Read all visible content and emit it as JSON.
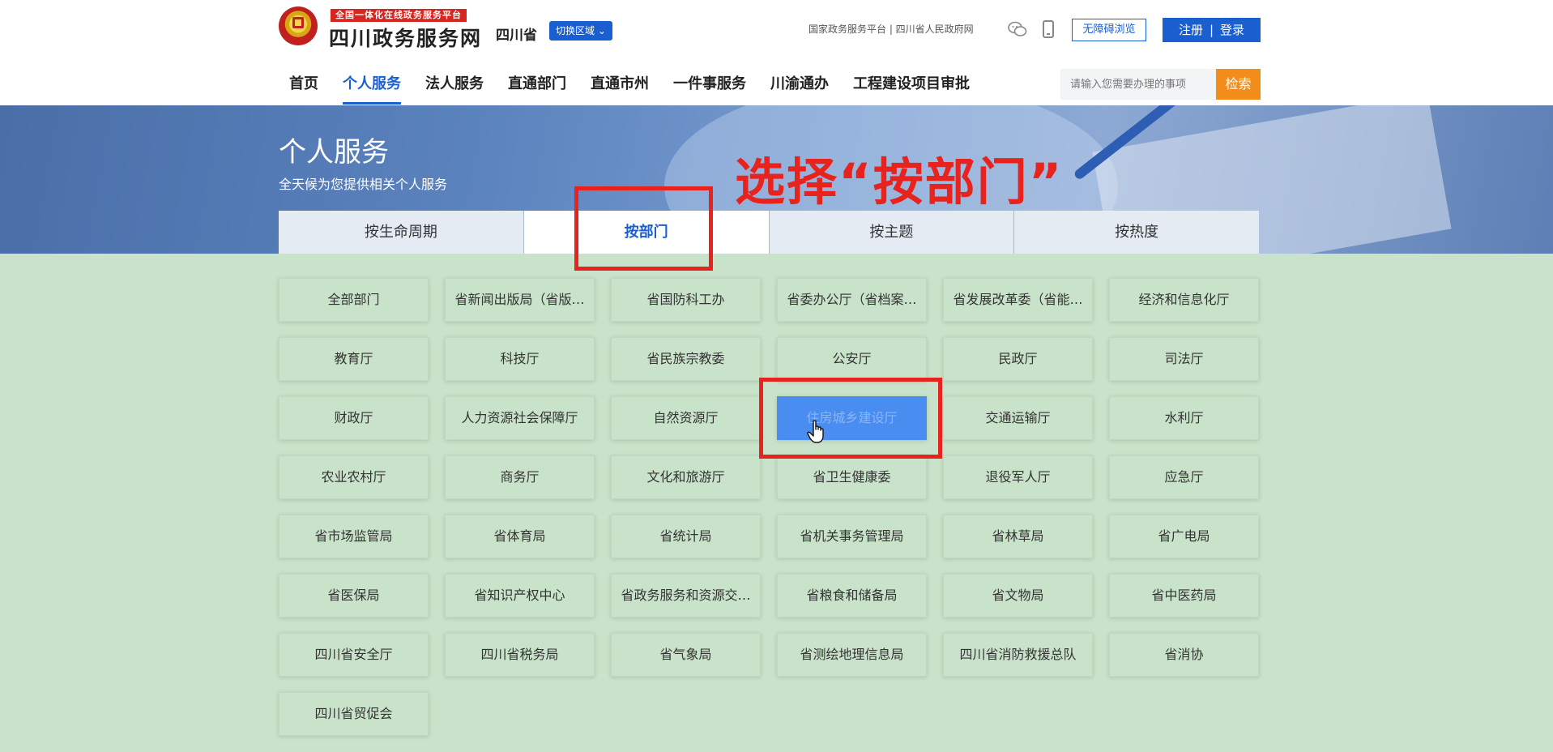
{
  "header": {
    "platform_tag": "全国一体化在线政务服务平台",
    "site_title": "四川政务服务网",
    "province": "四川省",
    "switch_region": "切换区域 ⌄",
    "top_links": "国家政务服务平台 | 四川省人民政府网",
    "accessible_label": "无障碍浏览",
    "register_label": "注册",
    "login_separator": "|",
    "login_label": "登录",
    "search_placeholder": "请输入您需要办理的事项",
    "search_button": "检索"
  },
  "nav": {
    "items": [
      {
        "label": "首页"
      },
      {
        "label": "个人服务",
        "active": true
      },
      {
        "label": "法人服务"
      },
      {
        "label": "直通部门"
      },
      {
        "label": "直通市州"
      },
      {
        "label": "一件事服务"
      },
      {
        "label": "川渝通办"
      },
      {
        "label": "工程建设项目审批"
      }
    ]
  },
  "banner": {
    "title": "个人服务",
    "subtitle": "全天候为您提供相关个人服务",
    "annotation": "选择“按部门”"
  },
  "tabs": [
    {
      "label": "按生命周期"
    },
    {
      "label": "按部门",
      "active": true
    },
    {
      "label": "按主题"
    },
    {
      "label": "按热度"
    }
  ],
  "departments": [
    "全部部门",
    "省新闻出版局（省版…",
    "省国防科工办",
    "省委办公厅（省档案…",
    "省发展改革委（省能…",
    "经济和信息化厅",
    "教育厅",
    "科技厅",
    "省民族宗教委",
    "公安厅",
    "民政厅",
    "司法厅",
    "财政厅",
    "人力资源社会保障厅",
    "自然资源厅",
    "住房城乡建设厅",
    "交通运输厅",
    "水利厅",
    "农业农村厅",
    "商务厅",
    "文化和旅游厅",
    "省卫生健康委",
    "退役军人厅",
    "应急厅",
    "省市场监管局",
    "省体育局",
    "省统计局",
    "省机关事务管理局",
    "省林草局",
    "省广电局",
    "省医保局",
    "省知识产权中心",
    "省政务服务和资源交…",
    "省粮食和储备局",
    "省文物局",
    "省中医药局",
    "四川省安全厅",
    "四川省税务局",
    "省气象局",
    "省测绘地理信息局",
    "四川省消防救援总队",
    "省消协",
    "四川省贸促会"
  ],
  "selected_department": "住房城乡建设厅",
  "colors": {
    "brand_blue": "#1a5fd0",
    "search_orange": "#f28c1b",
    "annotation_red": "#e8231d",
    "page_bg": "#c8e3c9",
    "selected_bg": "#4a8df0"
  }
}
